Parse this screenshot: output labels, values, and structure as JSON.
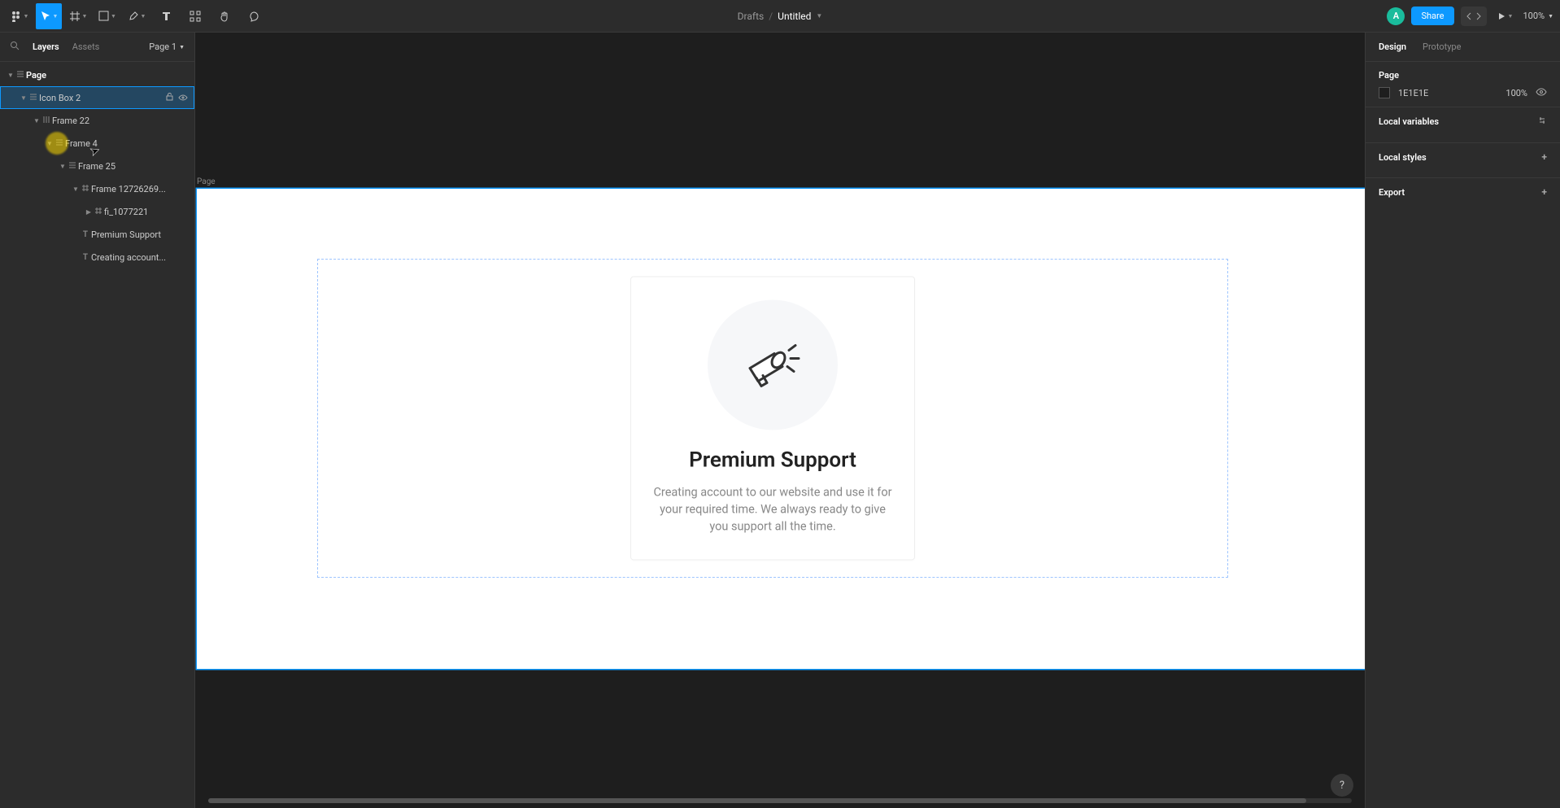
{
  "toolbar": {
    "breadcrumb": {
      "drafts": "Drafts",
      "separator": "/",
      "title": "Untitled"
    },
    "avatar_letter": "A",
    "share_label": "Share",
    "zoom": "100%"
  },
  "left_panel": {
    "tabs": {
      "layers": "Layers",
      "assets": "Assets"
    },
    "page_selector": "Page 1",
    "layers": [
      {
        "name": "Page",
        "indent": 0,
        "kind": "page",
        "expanded": true,
        "root": true
      },
      {
        "name": "Icon Box 2",
        "indent": 1,
        "kind": "auto",
        "expanded": true,
        "selected": true,
        "show_actions": true
      },
      {
        "name": "Frame 22",
        "indent": 2,
        "kind": "auto-h",
        "expanded": true
      },
      {
        "name": "Frame 4",
        "indent": 3,
        "kind": "auto",
        "expanded": true
      },
      {
        "name": "Frame 25",
        "indent": 4,
        "kind": "auto",
        "expanded": true
      },
      {
        "name": "Frame 12726269...",
        "indent": 5,
        "kind": "frame",
        "expanded": true
      },
      {
        "name": "fi_1077221",
        "indent": 6,
        "kind": "frame",
        "expanded": false,
        "has_children": true
      },
      {
        "name": "Premium Support",
        "indent": 5,
        "kind": "text"
      },
      {
        "name": "Creating account...",
        "indent": 5,
        "kind": "text"
      }
    ]
  },
  "canvas": {
    "frame_label": "Page",
    "card": {
      "title": "Premium Support",
      "body": "Creating account to our website and use it for your required time. We always ready to give you support all the time."
    }
  },
  "right_panel": {
    "tabs": {
      "design": "Design",
      "prototype": "Prototype"
    },
    "page_section": {
      "title": "Page",
      "fill_hex": "1E1E1E",
      "opacity": "100%"
    },
    "local_variables": "Local variables",
    "local_styles": "Local styles",
    "export": "Export"
  },
  "help": "?"
}
